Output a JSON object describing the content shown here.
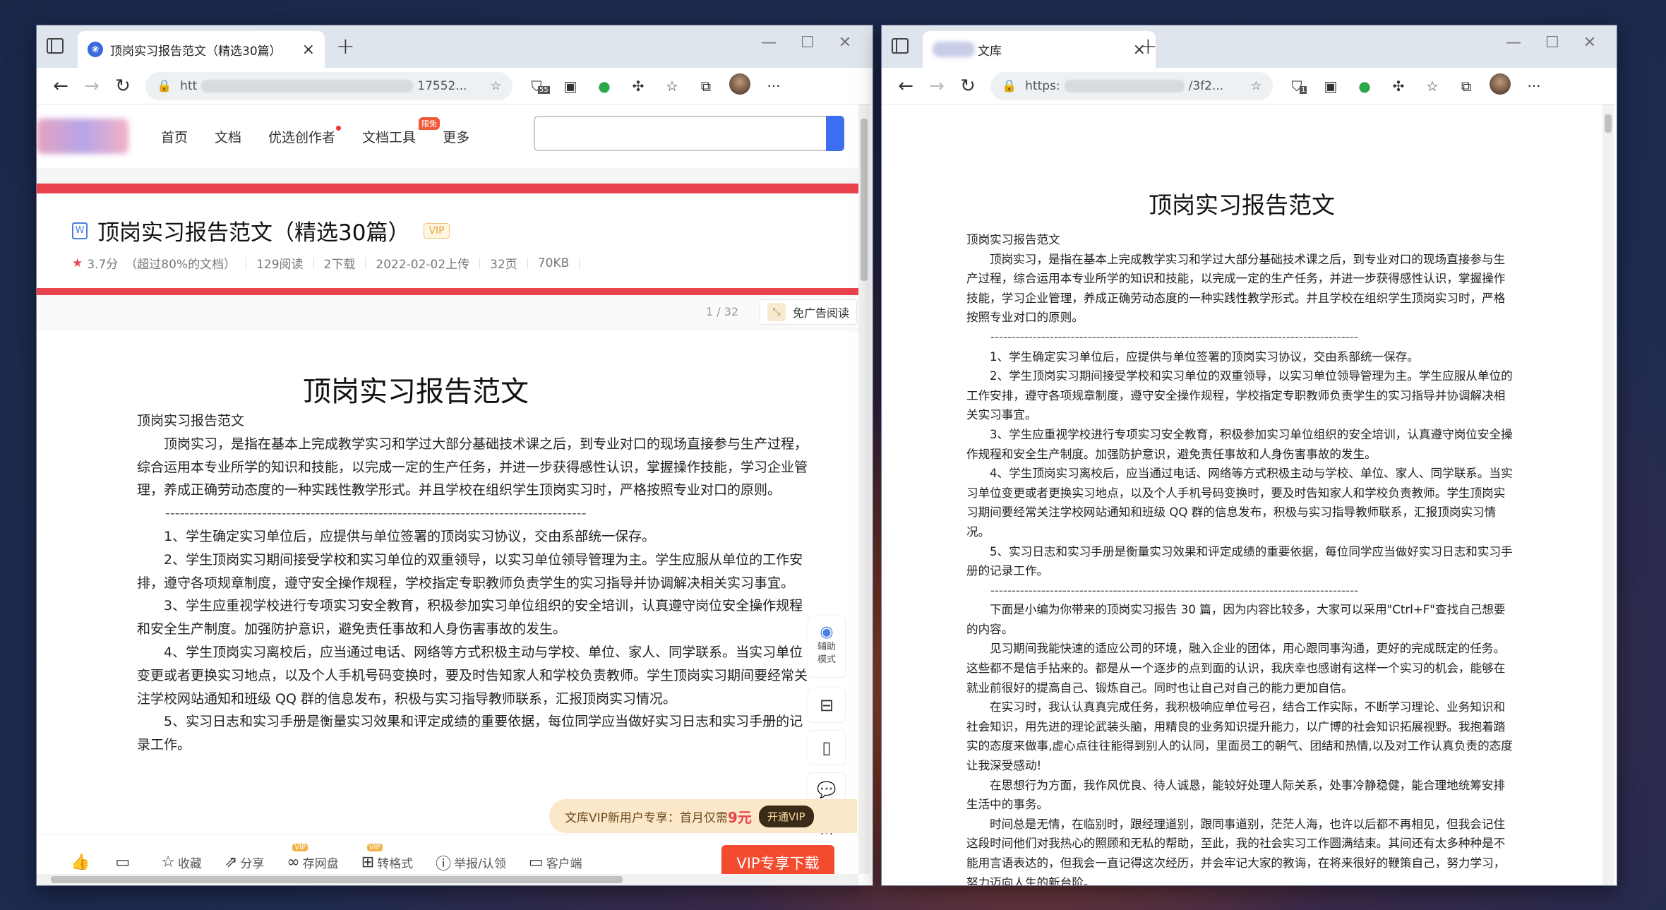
{
  "left_window": {
    "tab_title": "顶岗实习报告范文（精选30篇）",
    "url_start": "htt",
    "url_end": "17552...",
    "ext_badge_count": "55",
    "site_nav": {
      "items": [
        "首页",
        "文档",
        "优选创作者",
        "文档工具",
        "更多"
      ],
      "hot_badge": "限免"
    },
    "doc_header": {
      "title": "顶岗实习报告范文（精选30篇）",
      "vip_label": "VIP",
      "rating": "3.7分",
      "rating_note": "（超过80%的文档）",
      "reads": "129阅读",
      "downloads": "2下载",
      "upload_date": "2022-02-02上传",
      "pages": "32页",
      "size": "70KB"
    },
    "page_indicator": "1 / 32",
    "adfree_label": "免广告阅读",
    "doc": {
      "title": "顶岗实习报告范文",
      "subtitle": "顶岗实习报告范文",
      "intro": "顶岗实习，是指在基本上完成教学实习和学过大部分基础技术课之后，到专业对口的现场直接参与生产过程，综合运用本专业所学的知识和技能，以完成一定的生产任务，并进一步获得感性认识，掌握操作技能，学习企业管理，养成正确劳动态度的一种实践性教学形式。并且学校在组织学生顶岗实习时，严格按照专业对口的原则。",
      "dashes": "---------------------------------------------------------------------------------------",
      "p1": "1、学生确定实习单位后，应提供与单位签署的顶岗实习协议，交由系部统一保存。",
      "p2": "2、学生顶岗实习期间接受学校和实习单位的双重领导，以实习单位领导管理为主。学生应服从单位的工作安排，遵守各项规章制度，遵守安全操作规程，学校指定专职教师负责学生的实习指导并协调解决相关实习事宜。",
      "p3": "3、学生应重视学校进行专项实习安全教育，积极参加实习单位组织的安全培训，认真遵守岗位安全操作规程和安全生产制度。加强防护意识，避免责任事故和人身伤害事故的发生。",
      "p4": "4、学生顶岗实习离校后，应当通过电话、网络等方式积极主动与学校、单位、家人、同学联系。当实习单位变更或者更换实习地点，以及个人手机号码变换时，要及时告知家人和学校负责教师。学生顶岗实习期间要经常关注学校网站通知和班级 QQ 群的信息发布，积极与实习指导教师联系，汇报顶岗实习情况。",
      "p5": "5、实习日志和实习手册是衡量实习效果和评定成绩的重要依据，每位同学应当做好实习日志和实习手册的记录工作。"
    },
    "float_sidebar": {
      "assist_label": "辅助模式"
    },
    "promo": {
      "text": "文库VIP新用户专享：首月仅需",
      "price": "9元",
      "button": "开通VIP"
    },
    "bottom_bar": {
      "collect": "收藏",
      "share": "分享",
      "save_disk": "存网盘",
      "convert": "转格式",
      "report": "举报/认领",
      "client": "客户端",
      "vip_badge": "VIP",
      "download": "VIP专享下载"
    }
  },
  "right_window": {
    "tab_title": "文库",
    "url_start": "https:",
    "url_end": "/3f2...",
    "ext_badge_count": "1",
    "doc": {
      "title": "顶岗实习报告范文",
      "subtitle": "顶岗实习报告范文",
      "intro": "顶岗实习，是指在基本上完成教学实习和学过大部分基础技术课之后，到专业对口的现场直接参与生产过程，综合运用本专业所学的知识和技能，以完成一定的生产任务，并进一步获得感性认识，掌握操作技能，学习企业管理，养成正确劳动态度的一种实践性教学形式。并且学校在组织学生顶岗实习时，严格按照专业对口的原则。",
      "dashes": "---------------------------------------------------------------------------------------",
      "p1": "1、学生确定实习单位后，应提供与单位签署的顶岗实习协议，交由系部统一保存。",
      "p2": "2、学生顶岗实习期间接受学校和实习单位的双重领导，以实习单位领导管理为主。学生应服从单位的工作安排，遵守各项规章制度，遵守安全操作规程，学校指定专职教师负责学生的实习指导并协调解决相关实习事宜。",
      "p3": "3、学生应重视学校进行专项实习安全教育，积极参加实习单位组织的安全培训，认真遵守岗位安全操作规程和安全生产制度。加强防护意识，避免责任事故和人身伤害事故的发生。",
      "p4": "4、学生顶岗实习离校后，应当通过电话、网络等方式积极主动与学校、单位、家人、同学联系。当实习单位变更或者更换实习地点，以及个人手机号码变换时，要及时告知家人和学校负责教师。学生顶岗实习期间要经常关注学校网站通知和班级 QQ 群的信息发布，积极与实习指导教师联系，汇报顶岗实习情况。",
      "p5": "5、实习日志和实习手册是衡量实习效果和评定成绩的重要依据，每位同学应当做好实习日志和实习手册的记录工作。",
      "p6": "下面是小编为你带来的顶岗实习报告 30 篇，因为内容比较多，大家可以采用\"Ctrl+F\"查找自己想要的内容。",
      "p7": "见习期间我能快速的适应公司的环境，融入企业的团体，用心跟同事沟通，更好的完成既定的任务。这些都不是信手拈来的。都是从一个逐步的点到面的认识，我庆幸也感谢有这样一个实习的机会，能够在就业前很好的提高自己、锻炼自己。同时也让自己对自己的能力更加自信。",
      "p8": "在实习时，我认认真真完成任务，我积极响应单位号召，结合工作实际，不断学习理论、业务知识和社会知识，用先进的理论武装头脑，用精良的业务知识提升能力，以广博的社会知识拓展视野。我抱着踏实的态度来做事,虚心点往往能得到别人的认同，里面员工的朝气、团结和热情,以及对工作认真负责的态度让我深受感动!",
      "p9": "在思想行为方面，我作风优良、待人诚恳，能较好处理人际关系，处事冷静稳健，能合理地统筹安排生活中的事务。",
      "p10": "时间总是无情，在临别时，跟经理道别，跟同事道别，茫茫人海，也许以后都不再相见，但我会记住这段时间他们对我热心的照顾和无私的帮助，至此，我的社会实习工作圆满结束。其间还有太多种种是不能用言语表达的，但我会一直记得这次经历，并会牢记大家的教诲，在将来很好的鞭策自己，努力学习，努力迈向人生的新台阶。"
    }
  }
}
